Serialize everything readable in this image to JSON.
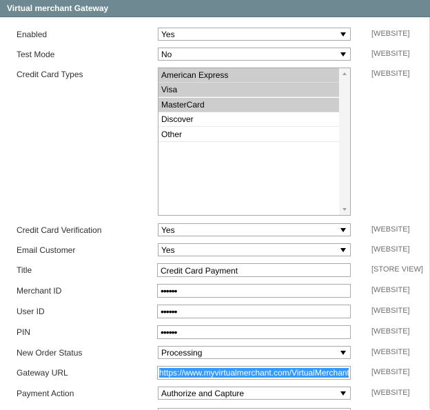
{
  "section": {
    "title": "Virtual merchant Gateway"
  },
  "fields": {
    "enabled": {
      "label": "Enabled",
      "value": "Yes",
      "scope": "[WEBSITE]"
    },
    "test_mode": {
      "label": "Test Mode",
      "value": "No",
      "scope": "[WEBSITE]"
    },
    "credit_card_types": {
      "label": "Credit Card Types",
      "scope": "[WEBSITE]",
      "options": [
        {
          "label": "American Express",
          "selected": true
        },
        {
          "label": "Visa",
          "selected": true
        },
        {
          "label": "MasterCard",
          "selected": true
        },
        {
          "label": "Discover",
          "selected": false
        },
        {
          "label": "Other",
          "selected": false
        }
      ]
    },
    "cc_verification": {
      "label": "Credit Card Verification",
      "value": "Yes",
      "scope": "[WEBSITE]"
    },
    "email_customer": {
      "label": "Email Customer",
      "value": "Yes",
      "scope": "[WEBSITE]"
    },
    "title": {
      "label": "Title",
      "value": "Credit Card Payment",
      "scope": "[STORE VIEW]"
    },
    "merchant_id": {
      "label": "Merchant ID",
      "value": "••••••",
      "scope": "[WEBSITE]"
    },
    "user_id": {
      "label": "User ID",
      "value": "••••••",
      "scope": "[WEBSITE]"
    },
    "pin": {
      "label": "PIN",
      "value": "••••••",
      "scope": "[WEBSITE]"
    },
    "new_order_status": {
      "label": "New Order Status",
      "value": "Processing",
      "scope": "[WEBSITE]"
    },
    "gateway_url": {
      "label": "Gateway URL",
      "value": "https://www.myvirtualmerchant.com/VirtualMerchant/process.do",
      "scope": "[WEBSITE]"
    },
    "payment_action": {
      "label": "Payment Action",
      "value": "Authorize and Capture",
      "scope": "[WEBSITE]"
    }
  },
  "colors": {
    "header_bg": "#6f8992",
    "selected_option_bg": "#cdcdcd",
    "url_highlight_bg": "#3399ff"
  }
}
